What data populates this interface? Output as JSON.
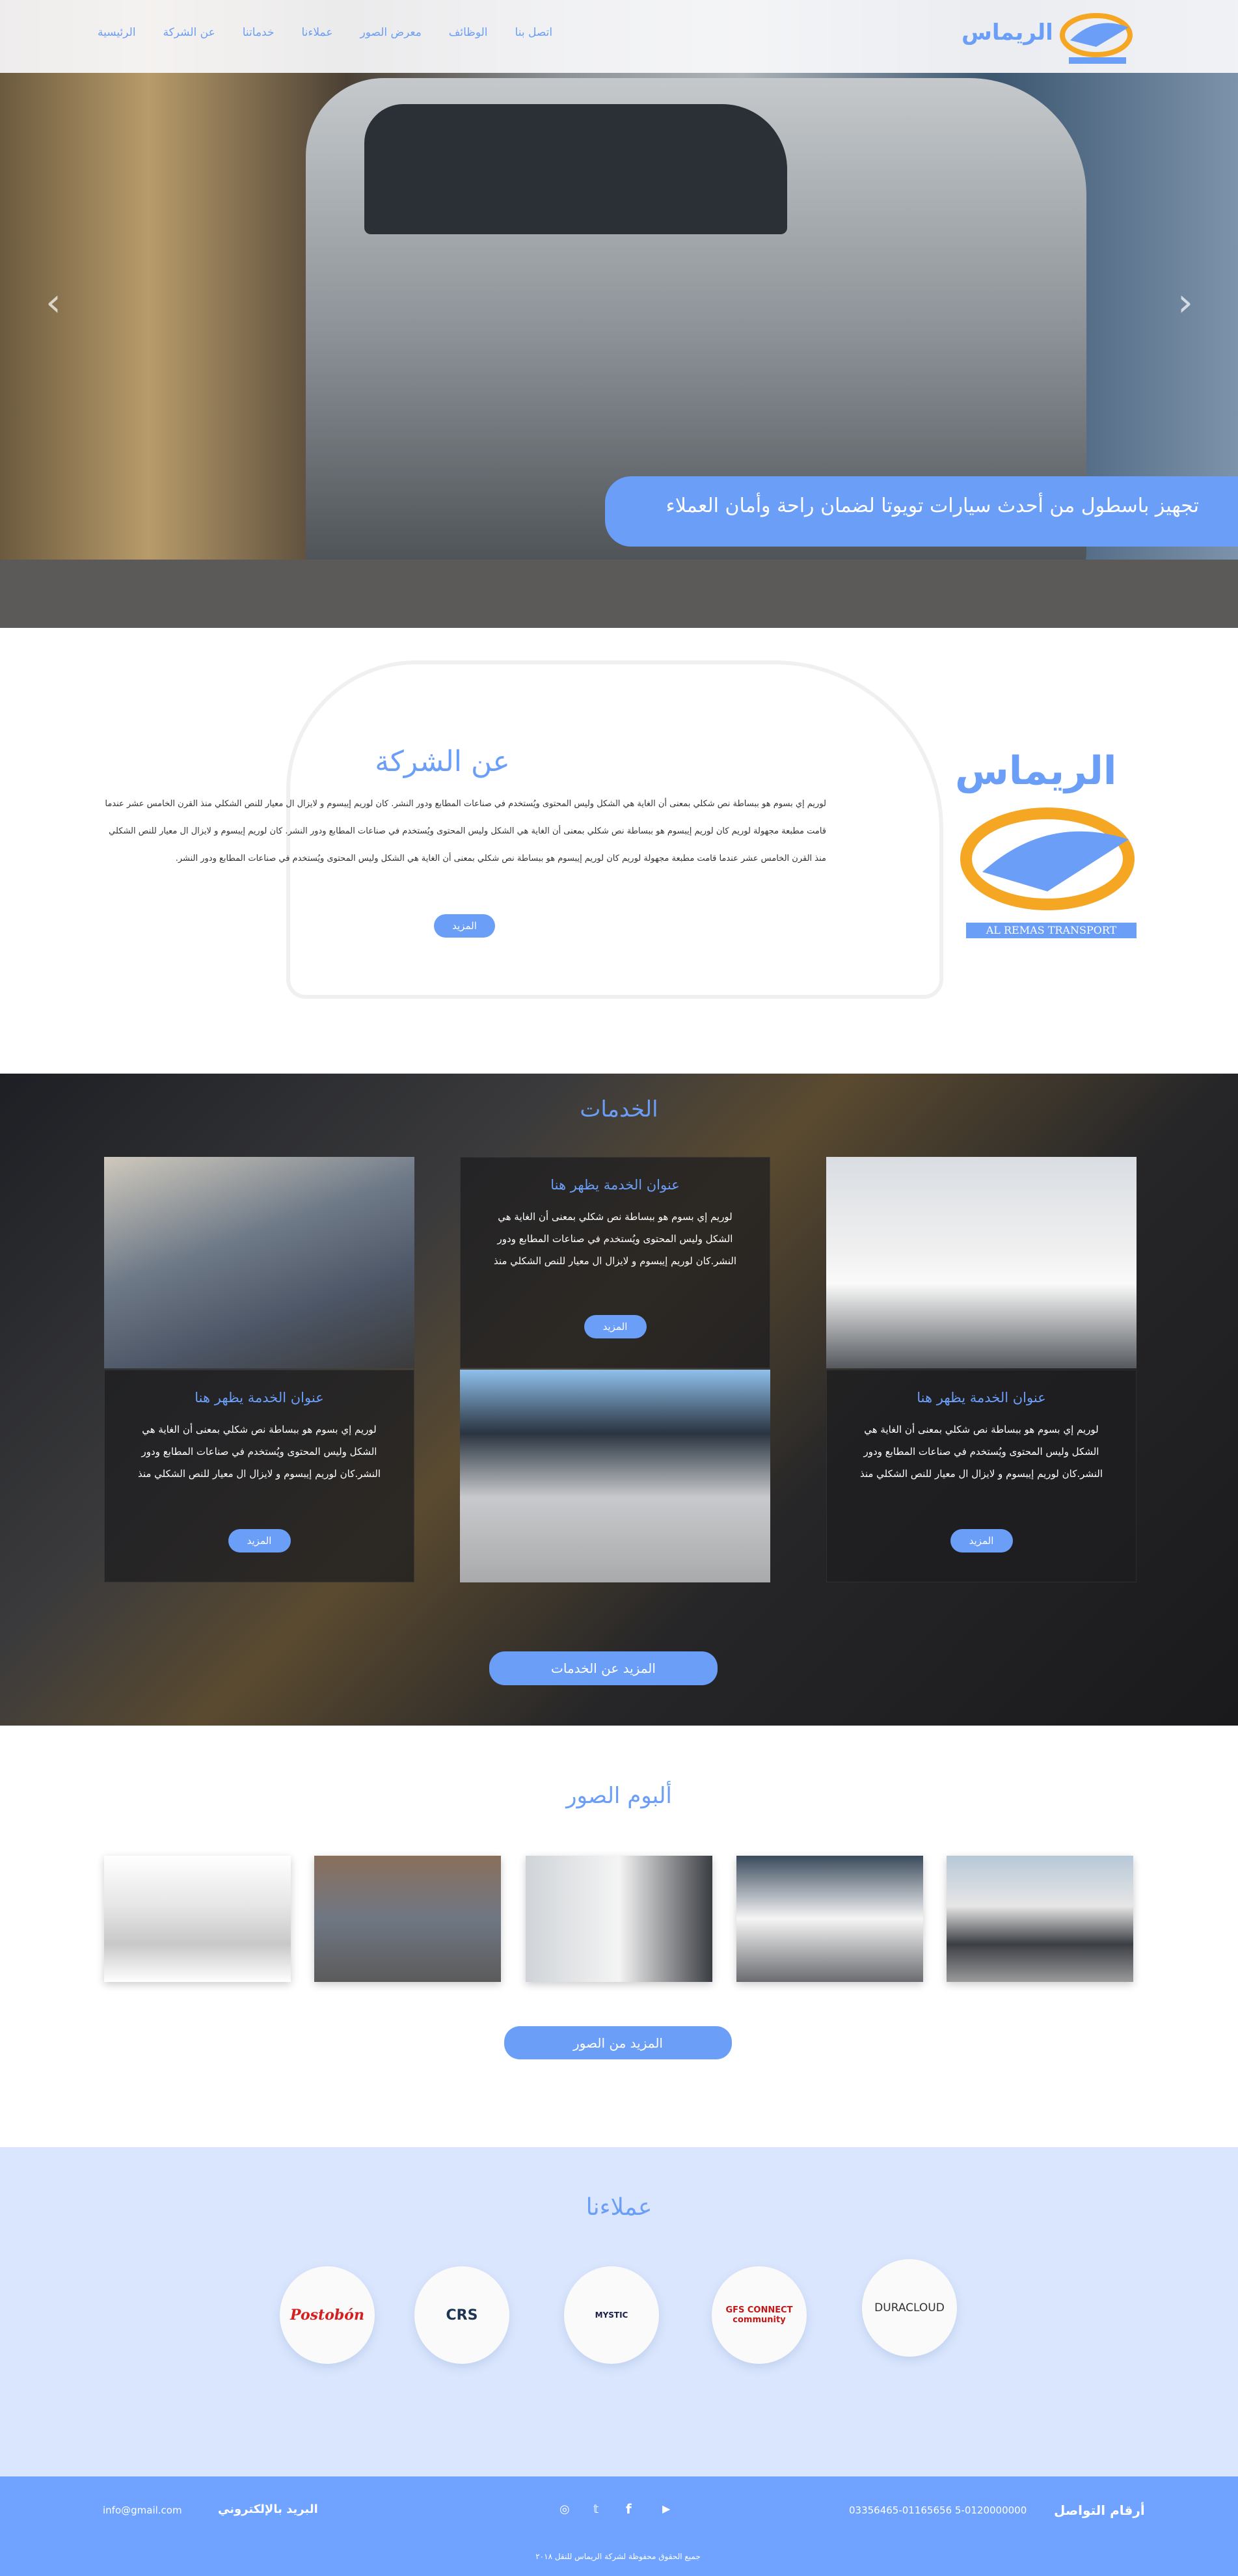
{
  "brand": {
    "name_ar": "الريماس",
    "name_en": "AL REMAS TRANSPORT",
    "accent": "#6b9ef7",
    "orange": "#f5a623"
  },
  "nav": {
    "items": [
      "الرئيسية",
      "عن الشركة",
      "خدماتنا",
      "عملاءنا",
      "معرض الصور",
      "الوظائف",
      "اتصل بنا"
    ]
  },
  "hero": {
    "caption": "تجهيز باسطول من أحدث سيارات تويوتا لضمان راحة وأمان العملاء",
    "prev_icon": "chevron-left-icon",
    "next_icon": "chevron-right-icon"
  },
  "about": {
    "title": "عن الشركة",
    "body": "لوريم إي بسوم هو ببساطة نص شكلي بمعنى أن الغاية هي الشكل وليس المحتوى ويُستخدم في صناعات المطابع ودور النشر. كان لوريم إيبسوم و لايزال ال معيار للنص الشكلي منذ القرن الخامس عشر عندما قامت مطبعة مجهولة لوريم كان لوريم إيبسوم هو ببساطة نص شكلي بمعنى أن الغاية هي الشكل وليس المحتوى ويُستخدم في صناعات المطابع ودور النشر. كان لوريم إيبسوم و لايزال ال معيار للنص الشكلي منذ القرن الخامس عشر عندما قامت مطبعة مجهولة لوريم كان لوريم إيبسوم هو ببساطة نص شكلي بمعنى أن الغاية هي الشكل وليس المحتوى ويُستخدم في صناعات المطابع ودور النشر.",
    "more": "المزيد"
  },
  "services": {
    "title": "الخدمات",
    "cards": [
      {
        "title": "عنوان الخدمة يظهر هنا",
        "body": "لوريم إي بسوم هو ببساطة نص شكلي بمعنى أن الغاية هي الشكل وليس المحتوى ويُستخدم في صناعات المطابع ودور النشر.كان لوريم إيبسوم و لايزال ال معيار للنص الشكلي منذ",
        "more": "المزيد"
      },
      {
        "title": "عنوان الخدمة يظهر هنا",
        "body": "لوريم إي بسوم هو ببساطة نص شكلي بمعنى أن الغاية هي الشكل وليس المحتوى ويُستخدم في صناعات المطابع ودور النشر.كان لوريم إيبسوم و لايزال ال معيار للنص الشكلي منذ",
        "more": "المزيد"
      },
      {
        "title": "عنوان الخدمة يظهر هنا",
        "body": "لوريم إي بسوم هو ببساطة نص شكلي بمعنى أن الغاية هي الشكل وليس المحتوى ويُستخدم في صناعات المطابع ودور النشر.كان لوريم إيبسوم و لايزال ال معيار للنص الشكلي منذ",
        "more": "المزيد"
      }
    ],
    "more_services": "المزيد عن الخدمات"
  },
  "gallery": {
    "title": "ألبوم الصور",
    "more": "المزيد من الصور"
  },
  "clients": {
    "title": "عملاءنا",
    "logos": [
      "Postobón",
      "CRS",
      "MYSTIC",
      "GFS CONNECT community",
      "DURACLOUD"
    ]
  },
  "footer": {
    "phones_label": "أرقام التواصل",
    "phones": "03356465-01165656 5-0120000000",
    "email_label": "البريد بالإلكتروني",
    "email": "info@gmail.com",
    "copyright": "جميع الحقوق محفوظة لشركة الريماس للنقل ٢٠١٨",
    "social": [
      "youtube-icon",
      "facebook-icon",
      "twitter-icon",
      "instagram-icon"
    ]
  }
}
